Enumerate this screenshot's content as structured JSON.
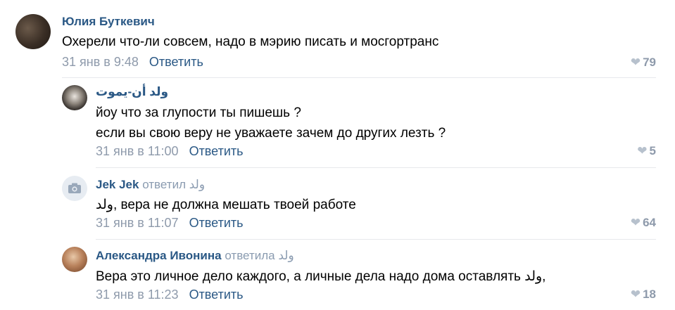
{
  "colors": {
    "link": "#2a5885",
    "muted": "#8e9aab",
    "divider": "#e7e8ec"
  },
  "comments": [
    {
      "author": "Юлия Буткевич",
      "replied_label": "",
      "replied_to": "",
      "lines": [
        "Охерели что-ли совсем, надо в мэрию писать и мосгортранс"
      ],
      "date": "31 янв в 9:48",
      "reply": "Ответить",
      "likes": "79",
      "avatar_icon": "user-photo"
    },
    {
      "author": "ولد أن-يموت",
      "replied_label": "",
      "replied_to": "",
      "lines": [
        "йоу что за глупости ты пишешь ?",
        "если вы свою веру не уважаете зачем до других лезть ?"
      ],
      "date": "31 янв в 11:00",
      "reply": "Ответить",
      "likes": "5",
      "avatar_icon": "user-photo"
    },
    {
      "author": "Jek Jek",
      "replied_label": "ответил",
      "replied_to": "ولد",
      "lines": [
        "ولد, вера не должна мешать твоей работе"
      ],
      "date": "31 янв в 11:07",
      "reply": "Ответить",
      "likes": "64",
      "avatar_icon": "camera-icon"
    },
    {
      "author": "Александра Ивонина",
      "replied_label": "ответила",
      "replied_to": "ولد",
      "lines": [
        "Вера это личное дело каждого, а личные дела надо дома оставлять ولد,"
      ],
      "date": "31 янв в 11:23",
      "reply": "Ответить",
      "likes": "18",
      "avatar_icon": "user-photo"
    }
  ]
}
